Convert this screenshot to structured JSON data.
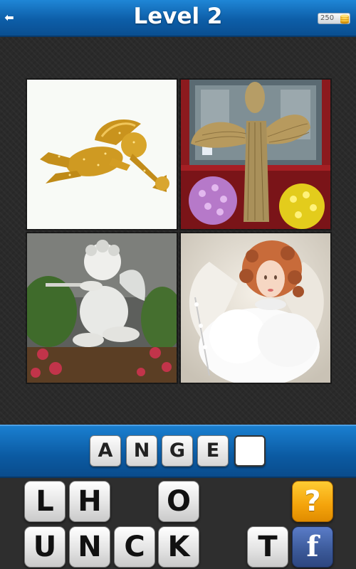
{
  "header": {
    "back_icon": "back-arrow-icon",
    "back_glyph": "⬅",
    "title": "Level 2",
    "coins": "250",
    "coin_icon": "coin-stack-icon"
  },
  "pictures": [
    {
      "subject": "gold-glitter-cherub-ornament"
    },
    {
      "subject": "woven-straw-angel-statue"
    },
    {
      "subject": "stone-cherub-statue-with-flute"
    },
    {
      "subject": "porcelain-angel-doll"
    }
  ],
  "answer": {
    "letters": [
      "A",
      "N",
      "G",
      "E",
      ""
    ]
  },
  "keyboard": {
    "row1": [
      "L",
      "H",
      "",
      "O"
    ],
    "row2": [
      "U",
      "N",
      "C",
      "K",
      "T"
    ],
    "hint_label": "?",
    "facebook_label": "f",
    "colors": {
      "hint": "#f4a30b",
      "facebook": "#3b5998",
      "header": "#0d5ea8"
    }
  }
}
